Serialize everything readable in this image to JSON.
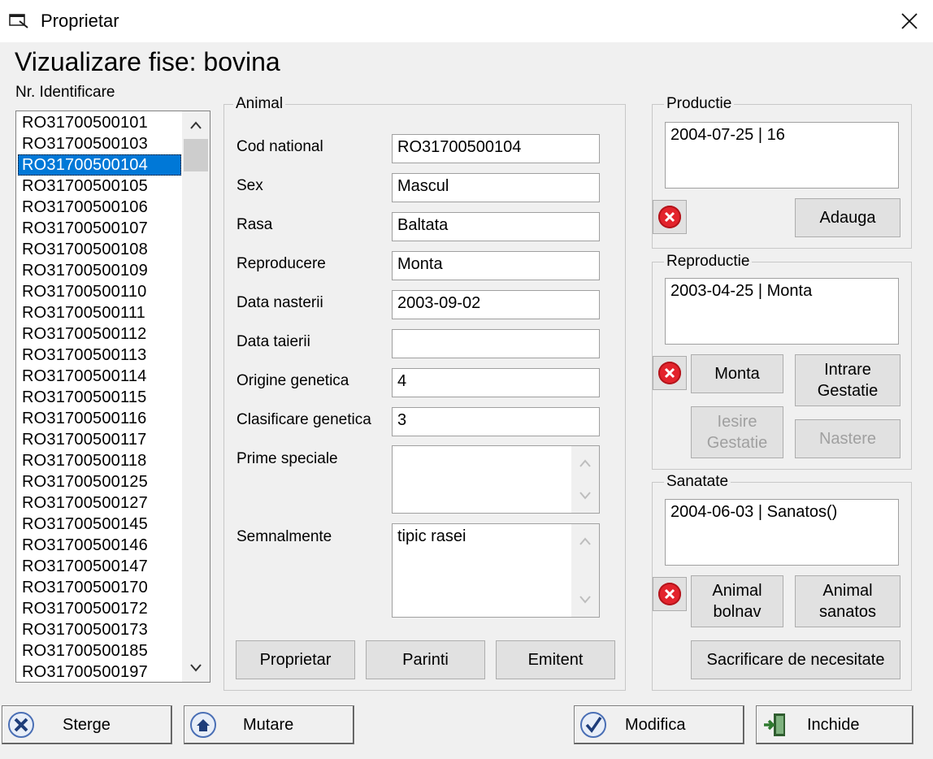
{
  "window": {
    "title": "Proprietar"
  },
  "heading": "Vizualizare fise: bovina",
  "id_list": {
    "label": "Nr. Identificare",
    "selected": "RO31700500104",
    "items": [
      "RO31700500101",
      "RO31700500103",
      "RO31700500104",
      "RO31700500105",
      "RO31700500106",
      "RO31700500107",
      "RO31700500108",
      "RO31700500109",
      "RO31700500110",
      "RO31700500111",
      "RO31700500112",
      "RO31700500113",
      "RO31700500114",
      "RO31700500115",
      "RO31700500116",
      "RO31700500117",
      "RO31700500118",
      "RO31700500125",
      "RO31700500127",
      "RO31700500145",
      "RO31700500146",
      "RO31700500147",
      "RO31700500170",
      "RO31700500172",
      "RO31700500173",
      "RO31700500185",
      "RO31700500197"
    ]
  },
  "animal": {
    "title": "Animal",
    "fields": {
      "cod_national": {
        "label": "Cod national",
        "value": "RO31700500104"
      },
      "sex": {
        "label": "Sex",
        "value": "Mascul"
      },
      "rasa": {
        "label": "Rasa",
        "value": "Baltata"
      },
      "reproducere": {
        "label": "Reproducere",
        "value": "Monta"
      },
      "data_nasterii": {
        "label": "Data nasterii",
        "value": "2003-09-02"
      },
      "data_taierii": {
        "label": "Data taierii",
        "value": ""
      },
      "origine_genetica": {
        "label": "Origine genetica",
        "value": "4"
      },
      "clasificare_genetica": {
        "label": "Clasificare genetica",
        "value": "3"
      },
      "prime_speciale": {
        "label": "Prime speciale",
        "value": ""
      },
      "semnalmente": {
        "label": "Semnalmente",
        "value": "tipic rasei"
      }
    },
    "buttons": {
      "proprietar": "Proprietar",
      "parinti": "Parinti",
      "emitent": "Emitent"
    }
  },
  "productie": {
    "title": "Productie",
    "entries": [
      "2004-07-25 | 16"
    ],
    "add_label": "Adauga"
  },
  "reproductie": {
    "title": "Reproductie",
    "entries": [
      "2003-04-25 | Monta"
    ],
    "monta": "Monta",
    "intrare_1": "Intrare",
    "intrare_2": "Gestatie",
    "iesire_1": "Iesire",
    "iesire_2": "Gestatie",
    "nastere": "Nastere"
  },
  "sanatate": {
    "title": "Sanatate",
    "entries": [
      "2004-06-03 | Sanatos()"
    ],
    "bolnav_1": "Animal",
    "bolnav_2": "bolnav",
    "sanatos_1": "Animal",
    "sanatos_2": "sanatos",
    "sacrificare": "Sacrificare de necesitate"
  },
  "footer": {
    "sterge": "Sterge",
    "mutare": "Mutare",
    "modifica": "Modifica",
    "inchide": "Inchide"
  },
  "colors": {
    "selection": "#0078d7",
    "delete_red": "#e3232c"
  }
}
